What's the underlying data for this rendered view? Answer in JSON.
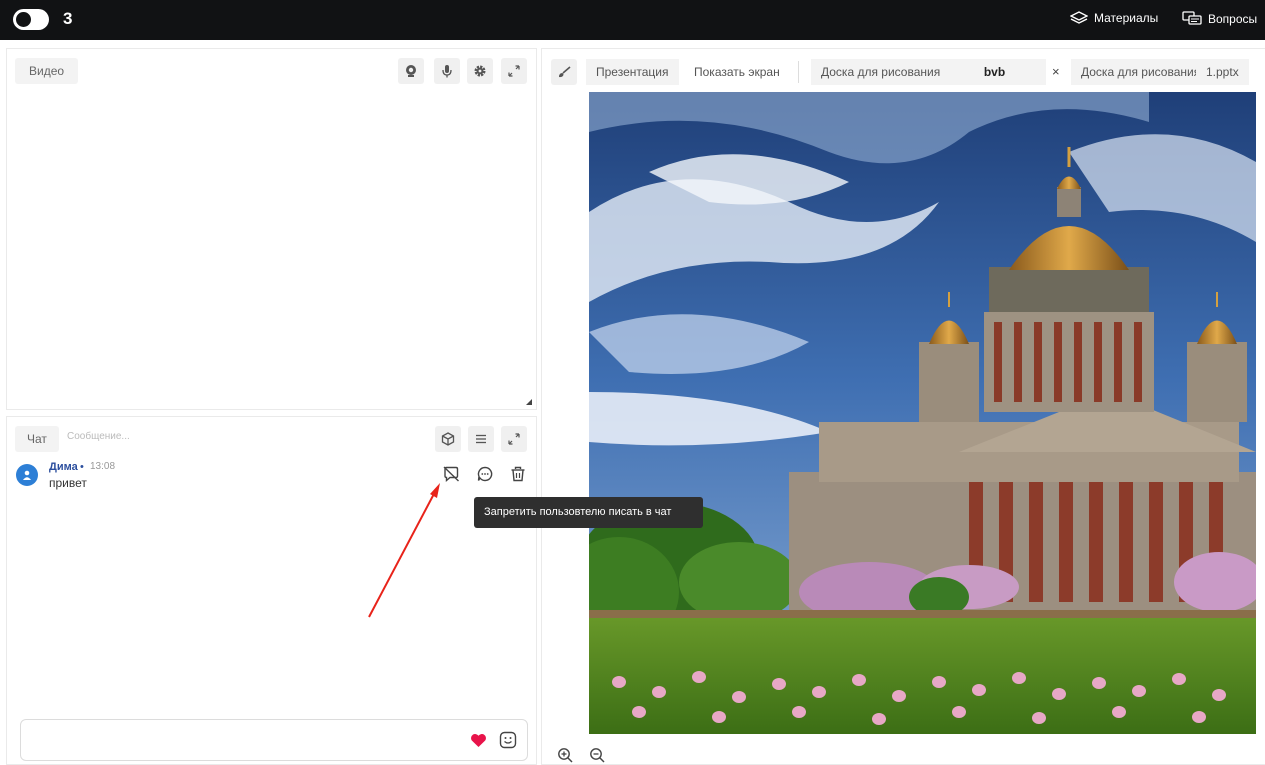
{
  "topbar": {
    "participant_count": "3",
    "materials_label": "Материалы",
    "questions_label": "Вопросы"
  },
  "video": {
    "label": "Видео"
  },
  "chat": {
    "label": "Чат",
    "message_placeholder": "Сообщение...",
    "messages": [
      {
        "author": "Дима",
        "separator": "•",
        "time": "13:08",
        "text": "привет"
      }
    ],
    "tooltip": "Запретить пользовтелю писать в чат"
  },
  "presentation": {
    "tabs": [
      {
        "label": "Презентация"
      },
      {
        "label": "Показать экран"
      },
      {
        "label": "Доска для рисования"
      },
      {
        "label": "bvb",
        "active": true
      },
      {
        "label": "Доска для рисования"
      },
      {
        "label": "1.pptx"
      }
    ],
    "close_symbol": "×"
  },
  "colors": {
    "topbar_bg": "#111214",
    "author": "#2c4f9e",
    "avatar": "#2d7fd6",
    "heart": "#e8134a",
    "arrow": "#e8231a",
    "tooltip_bg": "#2f2f2f"
  },
  "icons": [
    "toggle-icon",
    "materials-icon",
    "questions-icon",
    "camera-icon",
    "microphone-icon",
    "settings-icon",
    "expand-icon",
    "cube-icon",
    "menu-icon",
    "avatar-icon",
    "ban-chat-icon",
    "reply-icon",
    "delete-icon",
    "heart-icon",
    "emoji-icon",
    "brush-icon",
    "zoom-in-icon",
    "zoom-out-icon"
  ]
}
